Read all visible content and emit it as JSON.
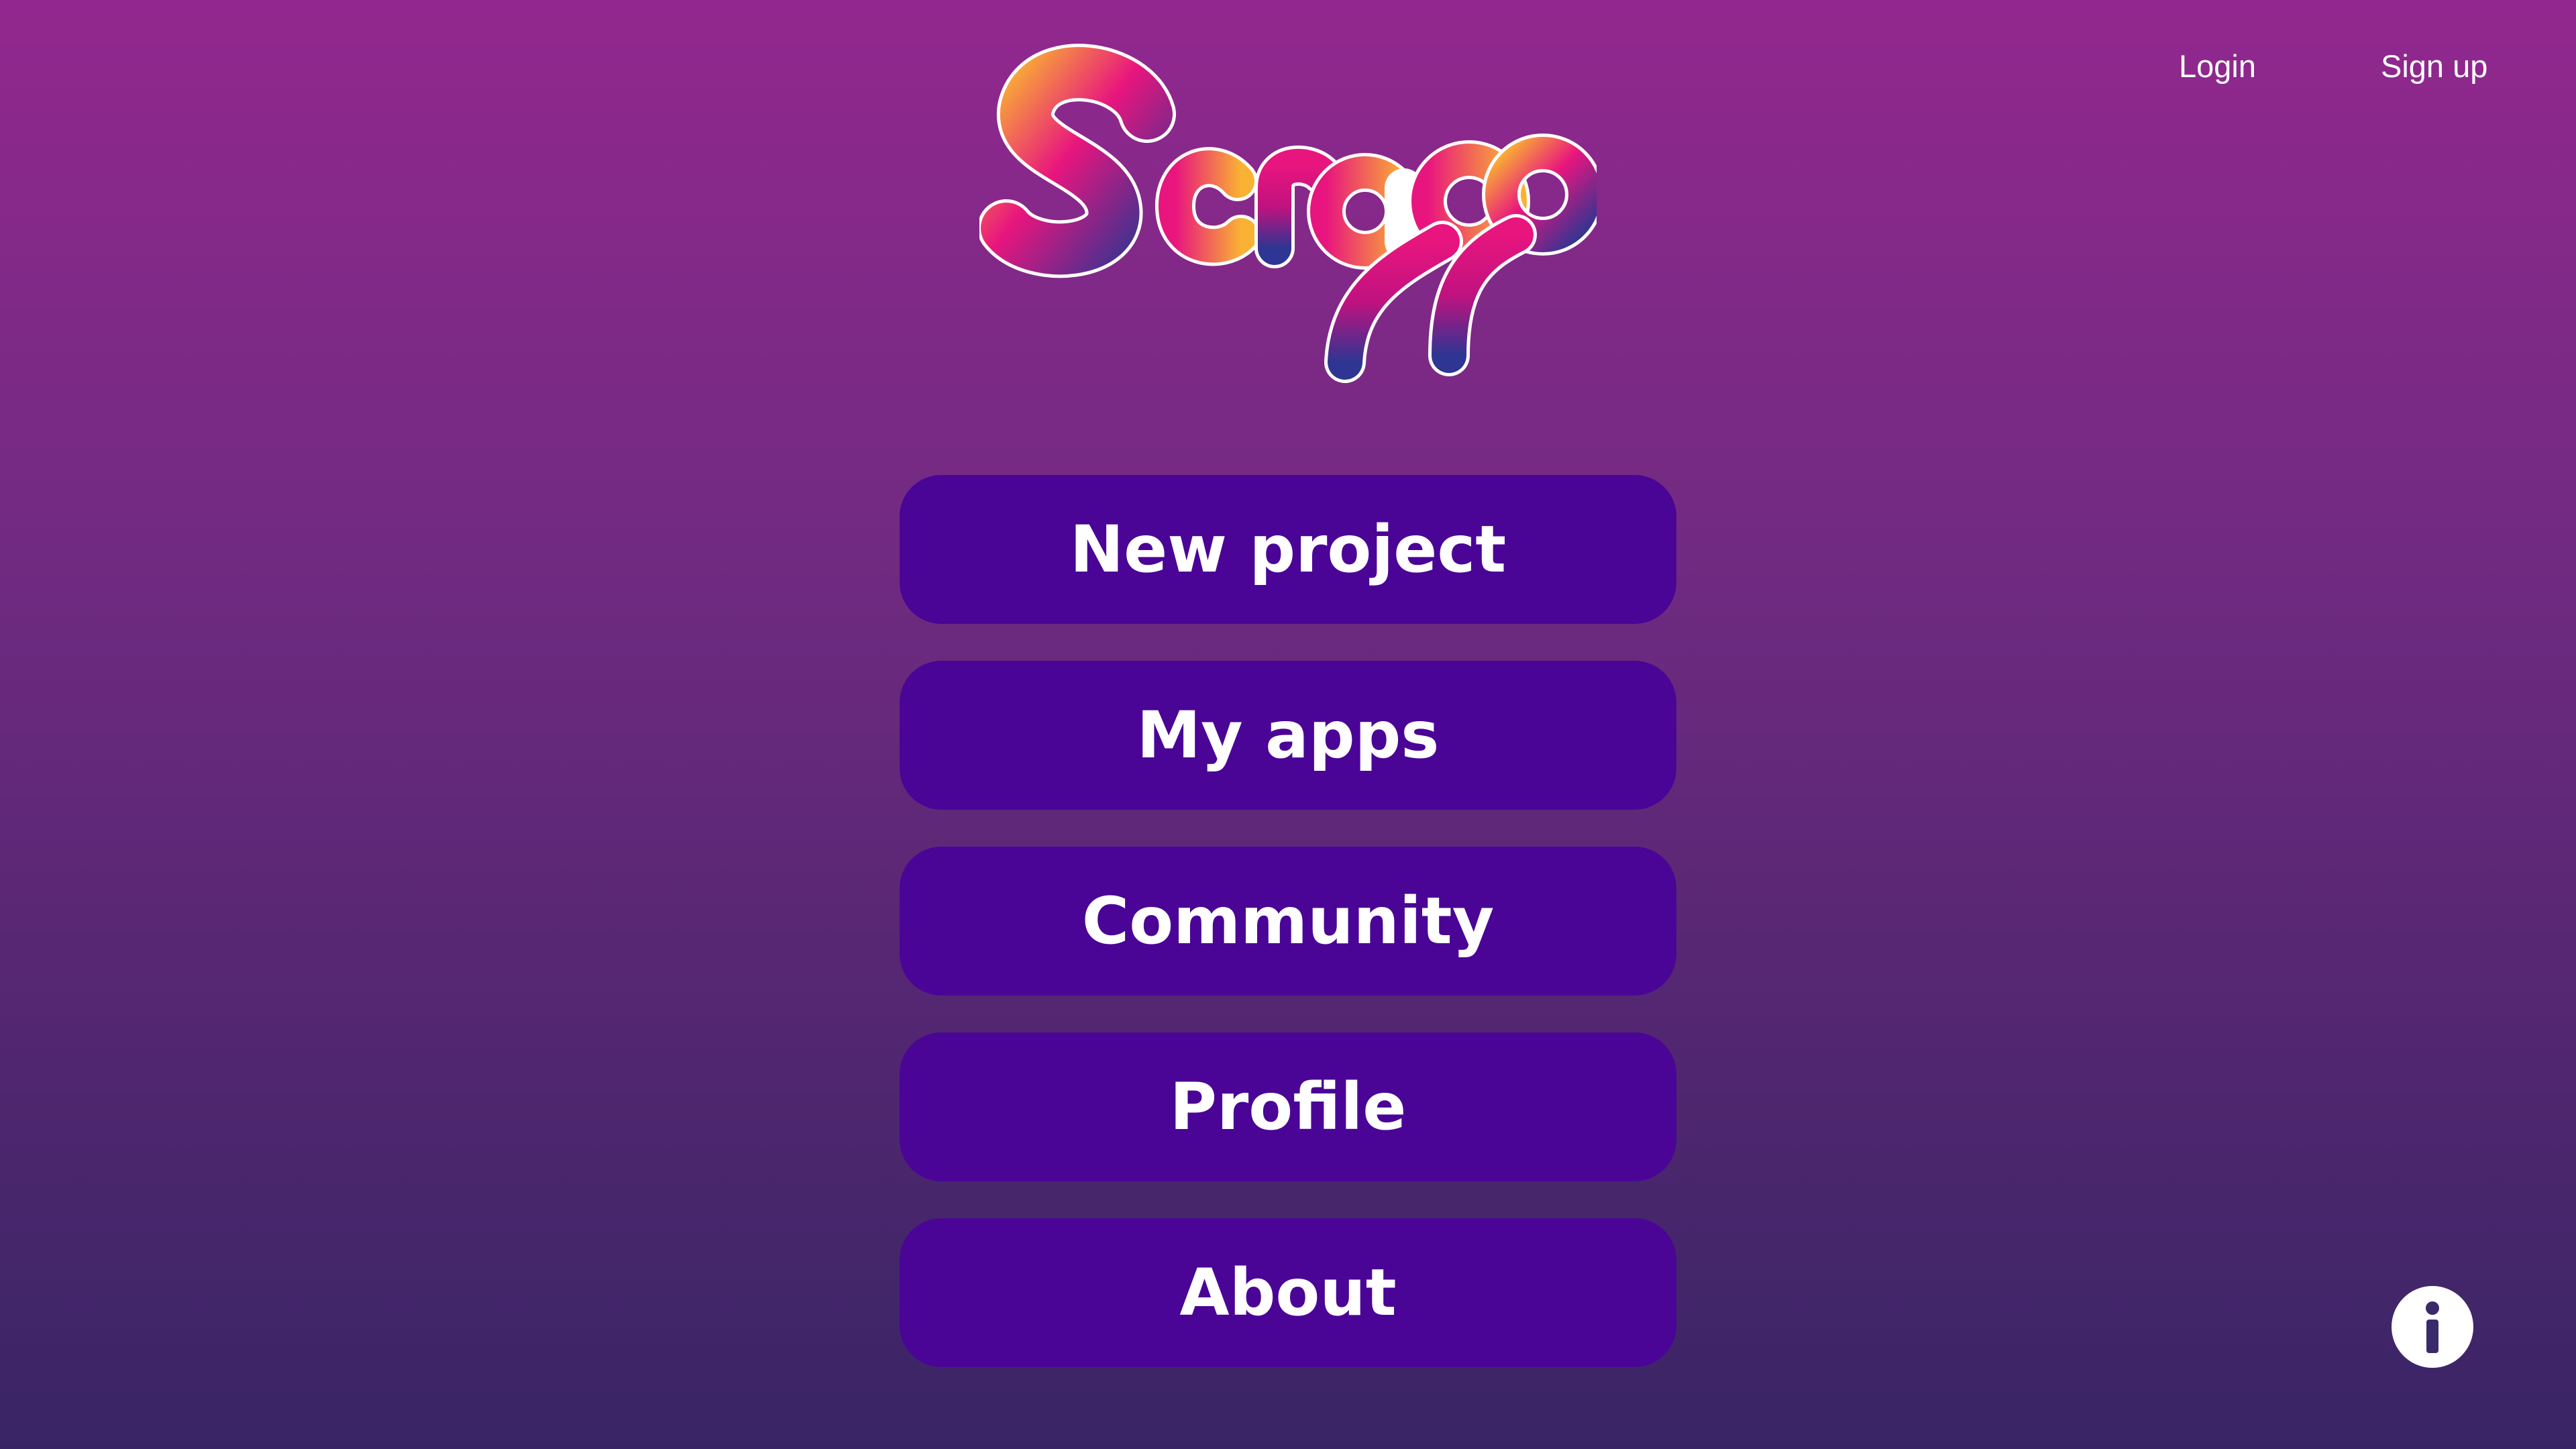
{
  "header": {
    "login_label": "Login",
    "signup_label": "Sign up"
  },
  "logo": {
    "text": "Scrapp",
    "icon": "scrapp-logo",
    "colors": [
      "#f9b233",
      "#e8157e",
      "#2e3592"
    ]
  },
  "menu": {
    "items": [
      {
        "label": "New project"
      },
      {
        "label": "My apps"
      },
      {
        "label": "Community"
      },
      {
        "label": "Profile"
      },
      {
        "label": "About"
      }
    ]
  },
  "info": {
    "icon": "info-icon"
  },
  "colors": {
    "button_bg": "#4a0596",
    "bg_top": "#92288f",
    "bg_bottom": "#392566",
    "text": "#ffffff"
  }
}
